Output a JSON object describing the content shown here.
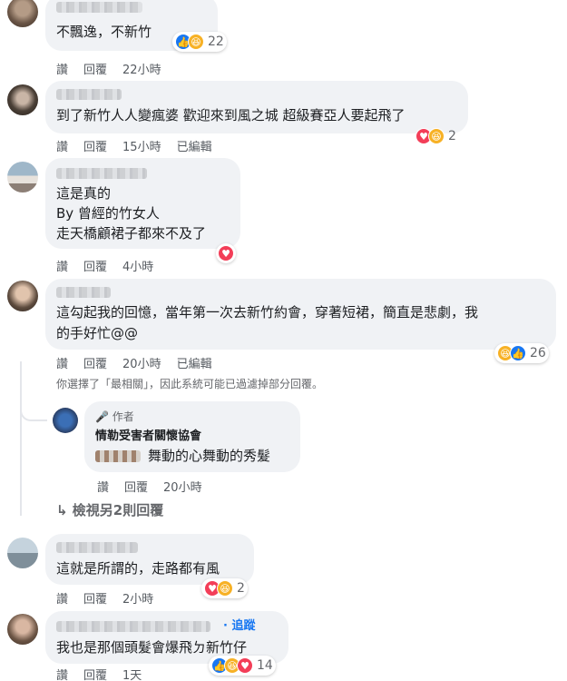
{
  "comments": [
    {
      "text": "不飄逸，不新竹",
      "actions": [
        "讚",
        "回覆",
        "22小時"
      ],
      "reactions": {
        "icons": [
          "like",
          "haha"
        ],
        "count": "22"
      }
    },
    {
      "text": "到了新竹人人變瘋婆 歡迎來到風之城 超級賽亞人要起飛了",
      "actions": [
        "讚",
        "回覆",
        "15小時",
        "已編輯"
      ],
      "reactions": {
        "icons": [
          "love",
          "haha"
        ],
        "count": "2"
      }
    },
    {
      "lines": [
        "這是真的",
        "By 曾經的竹女人",
        "走天橋顧裙子都來不及了"
      ],
      "actions": [
        "讚",
        "回覆",
        "4小時"
      ],
      "reactions": {
        "icons": [
          "love"
        ],
        "count": ""
      }
    },
    {
      "lines": [
        "這勾起我的回憶，當年第一次去新竹約會，穿著短裙，簡直是悲劇，我",
        "的手好忙@@"
      ],
      "actions": [
        "讚",
        "回覆",
        "20小時",
        "已編輯"
      ],
      "reactions": {
        "icons": [
          "haha",
          "like"
        ],
        "count": "26"
      }
    },
    {
      "text": "這就是所謂的，走路都有風",
      "actions": [
        "讚",
        "回覆",
        "2小時"
      ],
      "reactions": {
        "icons": [
          "love",
          "haha"
        ],
        "count": "2"
      }
    },
    {
      "text": "我也是那個頭髮會爆飛ㄉ新竹仔",
      "follow_label": "· 追蹤",
      "actions": [
        "讚",
        "回覆",
        "1天"
      ],
      "reactions": {
        "icons": [
          "like",
          "haha",
          "love"
        ],
        "count": "14"
      }
    }
  ],
  "filter_notice": "你選擇了「最相關」，因此系統可能已過濾掉部分回覆。",
  "reply": {
    "author_badge": "作者",
    "author_name": "情勒受害者關懷協會",
    "text": "舞動的心舞動的秀髮",
    "actions": [
      "讚",
      "回覆",
      "20小時"
    ]
  },
  "view_more": "↳ 檢視另2則回覆",
  "colors": {
    "like": "#1877f2",
    "love": "#f33e58",
    "haha": "#f7b125",
    "bubble": "#f0f2f5"
  }
}
